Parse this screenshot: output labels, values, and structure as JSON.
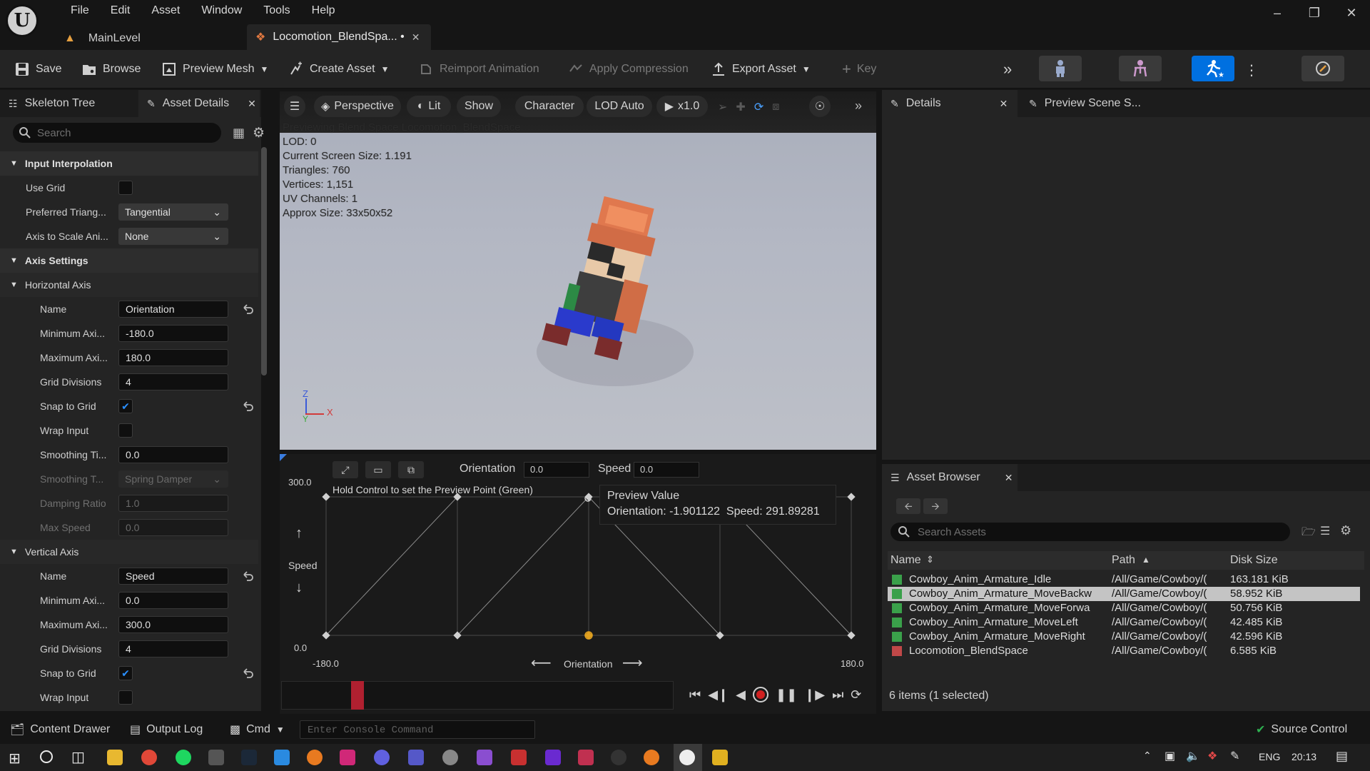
{
  "menu": [
    "File",
    "Edit",
    "Asset",
    "Window",
    "Tools",
    "Help"
  ],
  "tabs": {
    "level": "MainLevel",
    "active": "Locomotion_BlendSpa... •"
  },
  "toolbar": {
    "save": "Save",
    "browse": "Browse",
    "preview_mesh": "Preview Mesh",
    "create_asset": "Create Asset",
    "reimport": "Reimport Animation",
    "apply_compression": "Apply Compression",
    "export_asset": "Export Asset",
    "key": "Key"
  },
  "left_tabs": {
    "skeleton_tree": "Skeleton Tree",
    "asset_details": "Asset Details"
  },
  "search_placeholder": "Search",
  "properties": {
    "input_interpolation": "Input Interpolation",
    "use_grid": "Use Grid",
    "preferred_triangulation": {
      "label": "Preferred Triang...",
      "value": "Tangential"
    },
    "axis_to_scale": {
      "label": "Axis to Scale Ani...",
      "value": "None"
    },
    "axis_settings": "Axis Settings",
    "horizontal_axis": "Horizontal Axis",
    "h": {
      "name_label": "Name",
      "name": "Orientation",
      "min_label": "Minimum Axi...",
      "min": "-180.0",
      "max_label": "Maximum Axi...",
      "max": "180.0",
      "grid_label": "Grid Divisions",
      "grid": "4",
      "snap_label": "Snap to Grid",
      "snap": true,
      "wrap_label": "Wrap Input",
      "wrap": false,
      "smooth_time_label": "Smoothing Ti...",
      "smooth_time": "0.0",
      "smooth_type_label": "Smoothing T...",
      "smooth_type": "Spring Damper",
      "damping_label": "Damping Ratio",
      "damping": "1.0",
      "max_speed_label": "Max Speed",
      "max_speed": "0.0"
    },
    "vertical_axis": "Vertical Axis",
    "v": {
      "name_label": "Name",
      "name": "Speed",
      "min_label": "Minimum Axi...",
      "min": "0.0",
      "max_label": "Maximum Axi...",
      "max": "300.0",
      "grid_label": "Grid Divisions",
      "grid": "4",
      "snap_label": "Snap to Grid",
      "snap": true,
      "wrap_label": "Wrap Input",
      "wrap": false
    }
  },
  "viewport": {
    "buttons": [
      "Perspective",
      "Lit",
      "Show",
      "Character",
      "LOD Auto",
      "x1.0"
    ],
    "stats": [
      "Previewing Blend Space Locomotion_BlendSpace",
      "LOD: 0",
      "Current Screen Size: 1.191",
      "Triangles: 760",
      "Vertices: 1,151",
      "UV Channels: 1",
      "Approx Size: 33x50x52"
    ],
    "axis_z": "Z",
    "axis_x": "X",
    "axis_y": "Y"
  },
  "blend": {
    "orientation_label": "Orientation",
    "orientation_value": "0.0",
    "speed_label": "Speed",
    "speed_value": "0.0",
    "hint": "Hold Control to set the Preview Point (Green)",
    "y_top": "300.0",
    "y_bottom": "0.0",
    "y_axis": "Speed",
    "x_left": "-180.0",
    "x_right": "180.0",
    "x_axis": "Orientation",
    "tooltip_title": "Preview Value",
    "tooltip_value": "Orientation: -1.901122  Speed: 291.89281"
  },
  "right_tabs": {
    "details": "Details",
    "preview_scene": "Preview Scene S..."
  },
  "asset_browser": {
    "title": "Asset Browser",
    "search_placeholder": "Search Assets",
    "columns": [
      "Name",
      "Path",
      "Disk Size"
    ],
    "rows": [
      {
        "name": "Cowboy_Anim_Armature_Idle",
        "path": "/All/Game/Cowboy/(",
        "size": "163.181 KiB",
        "selected": false
      },
      {
        "name": "Cowboy_Anim_Armature_MoveBackw",
        "path": "/All/Game/Cowboy/(",
        "size": "58.952 KiB",
        "selected": true
      },
      {
        "name": "Cowboy_Anim_Armature_MoveForwa",
        "path": "/All/Game/Cowboy/(",
        "size": "50.756 KiB",
        "selected": false
      },
      {
        "name": "Cowboy_Anim_Armature_MoveLeft",
        "path": "/All/Game/Cowboy/(",
        "size": "42.485 KiB",
        "selected": false
      },
      {
        "name": "Cowboy_Anim_Armature_MoveRight",
        "path": "/All/Game/Cowboy/(",
        "size": "42.596 KiB",
        "selected": false
      },
      {
        "name": "Locomotion_BlendSpace",
        "path": "/All/Game/Cowboy/(",
        "size": "6.585 KiB",
        "selected": false
      }
    ],
    "status": "6 items (1 selected)"
  },
  "bottom": {
    "content_drawer": "Content Drawer",
    "output_log": "Output Log",
    "cmd": "Cmd",
    "console_placeholder": "Enter Console Command",
    "source_control": "Source Control"
  },
  "taskbar": {
    "lang": "ENG",
    "time": "20:13"
  },
  "colors": {
    "accent": "#0070e0",
    "check": "#2a8fff",
    "selected_row": "#c4c4c4",
    "record": "#d02020"
  }
}
